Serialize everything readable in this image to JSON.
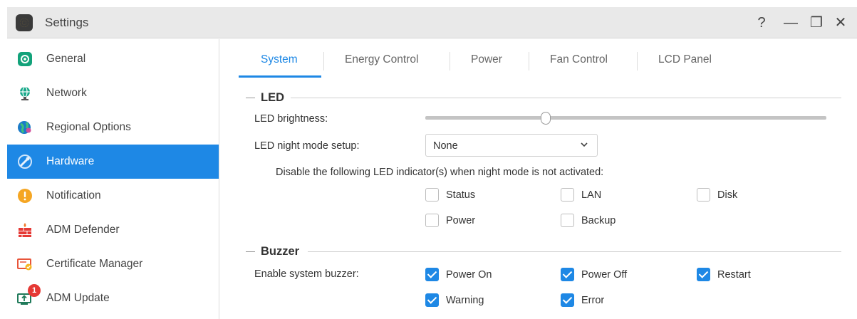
{
  "window": {
    "title": "Settings",
    "help_glyph": "?",
    "minimize_glyph": "—",
    "maximize_glyph": "❐",
    "close_glyph": "✕"
  },
  "sidebar": {
    "items": [
      {
        "label": "General",
        "icon": "general-icon"
      },
      {
        "label": "Network",
        "icon": "network-globe-icon"
      },
      {
        "label": "Regional Options",
        "icon": "regional-globe-icon"
      },
      {
        "label": "Hardware",
        "icon": "hardware-tools-icon",
        "active": true
      },
      {
        "label": "Notification",
        "icon": "warning-circle-icon"
      },
      {
        "label": "ADM Defender",
        "icon": "firewall-icon"
      },
      {
        "label": "Certificate Manager",
        "icon": "certificate-icon"
      },
      {
        "label": "ADM Update",
        "icon": "update-icon",
        "badge": "1"
      }
    ]
  },
  "tabs": [
    {
      "label": "System",
      "active": true
    },
    {
      "label": "Energy Control"
    },
    {
      "label": "Power"
    },
    {
      "label": "Fan Control"
    },
    {
      "label": "LCD Panel"
    }
  ],
  "led": {
    "section_title": "LED",
    "brightness_label": "LED brightness:",
    "brightness_level_fraction": 0.3,
    "night_mode_label": "LED night mode setup:",
    "night_mode_value": "None",
    "indicators_caption": "Disable the following LED indicator(s) when night mode is not activated:",
    "indicators": [
      {
        "label": "Status",
        "checked": false
      },
      {
        "label": "LAN",
        "checked": false
      },
      {
        "label": "Disk",
        "checked": false
      },
      {
        "label": "Power",
        "checked": false
      },
      {
        "label": "Backup",
        "checked": false
      }
    ]
  },
  "buzzer": {
    "section_title": "Buzzer",
    "enable_label": "Enable system buzzer:",
    "options": [
      {
        "label": "Power On",
        "checked": true
      },
      {
        "label": "Power Off",
        "checked": true
      },
      {
        "label": "Restart",
        "checked": true
      },
      {
        "label": "Warning",
        "checked": true
      },
      {
        "label": "Error",
        "checked": true
      }
    ]
  },
  "colors": {
    "accent": "#1e88e5",
    "badge": "#e53935"
  }
}
